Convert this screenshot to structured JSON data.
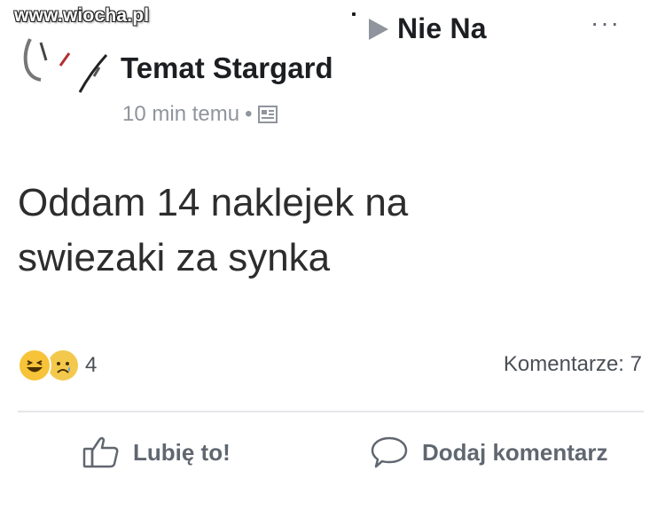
{
  "watermark": "www.wiocha.pl",
  "header": {
    "group_name": "Nie Na",
    "author": "Temat Stargard",
    "time": "10 min temu",
    "more": "···",
    "dot": "•"
  },
  "post": {
    "line1": "Oddam 14 naklejek na",
    "line2": "swiezaki za synka"
  },
  "reactions": {
    "count": "4",
    "types": [
      "haha",
      "sad"
    ]
  },
  "comments": {
    "label": "Komentarze: 7"
  },
  "actions": {
    "like": "Lubię to!",
    "comment": "Dodaj komentarz"
  },
  "colors": {
    "text": "#1c1e21",
    "secondary": "#90949c",
    "action": "#606770",
    "reaction_yellow": "#f7c339"
  }
}
